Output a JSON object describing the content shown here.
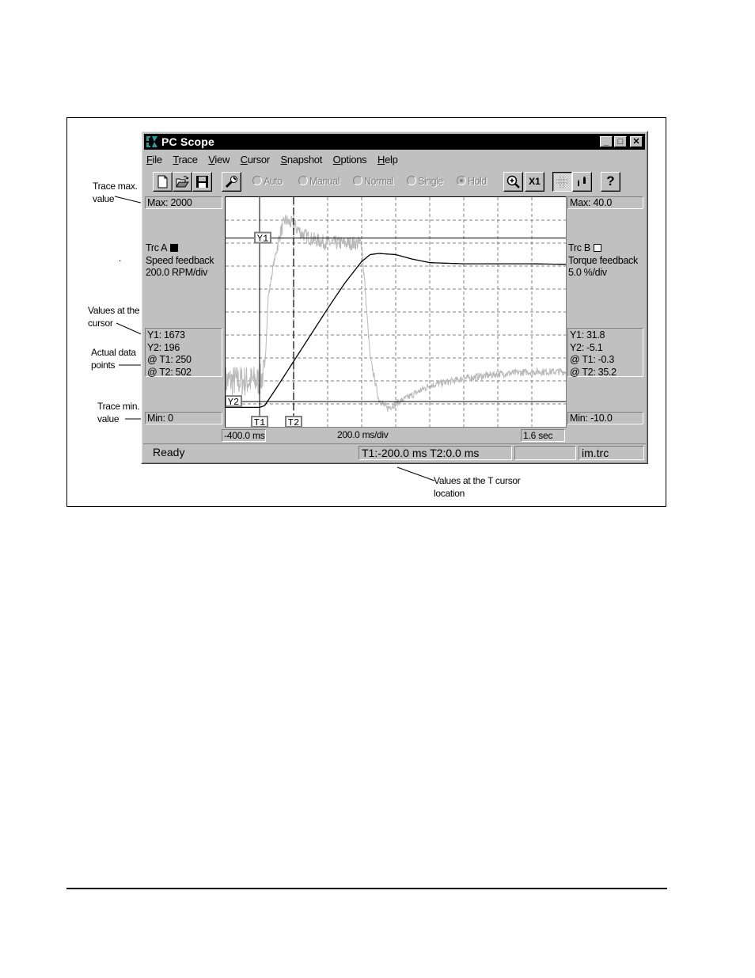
{
  "annotations": {
    "trace_max": "Trace max.\nvalue",
    "cursor_values": "Values at the\ncursor",
    "actual_points": "Actual data\npoints",
    "trace_min": "Trace min.\nvalue",
    "t_cursor": "Values at the T cursor\nlocation",
    "stray_dot": "."
  },
  "window": {
    "title": "PC Scope",
    "controls": {
      "minimize": "_",
      "maximize": "□",
      "close": "✕"
    }
  },
  "menu": [
    {
      "label": "File",
      "accel": "F",
      "rest": "ile"
    },
    {
      "label": "Trace",
      "accel": "T",
      "rest": "race"
    },
    {
      "label": "View",
      "accel": "V",
      "rest": "iew"
    },
    {
      "label": "Cursor",
      "accel": "C",
      "rest": "ursor"
    },
    {
      "label": "Snapshot",
      "accel": "S",
      "rest": "napshot"
    },
    {
      "label": "Options",
      "accel": "O",
      "rest": "ptions"
    },
    {
      "label": "Help",
      "accel": "H",
      "rest": "elp"
    }
  ],
  "toolbar": {
    "buttons": [
      "new-file",
      "open-folder",
      "save-disk",
      "wrench-settings",
      "zoom-in",
      "x1-scale",
      "grid-toggle",
      "cursor-hands",
      "help"
    ],
    "x1_label": "X1",
    "help_label": "?",
    "modes": [
      {
        "label": "Auto",
        "selected": false
      },
      {
        "label": "Manual",
        "selected": false
      },
      {
        "label": "Normal",
        "selected": false
      },
      {
        "label": "Single",
        "selected": false
      },
      {
        "label": "Hold",
        "selected": true
      }
    ]
  },
  "trace_a": {
    "max": "Max:  2000",
    "name": "Trc A",
    "swatch_color": "#000000",
    "signal": "Speed feedback",
    "scale": "200.0 RPM/div",
    "y1": "Y1: 1673",
    "y2": "Y2: 196",
    "t1": "@ T1: 250",
    "t2": "@ T2: 502",
    "min": "Min:  0"
  },
  "trace_b": {
    "max": "Max:  40.0",
    "name": "Trc B",
    "swatch_color": "#ffffff",
    "signal": "Torque feedback",
    "scale": "5.0 %/div",
    "y1": "Y1: 31.8",
    "y2": "Y2: -5.1",
    "t1": "@ T1: -0.3",
    "t2": "@ T2: 35.2",
    "min": "Min:  -10.0"
  },
  "time_axis": {
    "start": "-400.0 ms",
    "scale": "200.0 ms/div",
    "end": "1.6 sec"
  },
  "cursors": {
    "y1": "Y1",
    "y2": "Y2",
    "t1": "T1",
    "t2": "T2"
  },
  "status": {
    "state": "Ready",
    "cursor_times": "T1:-200.0 ms  T2:0.0 ms",
    "empty": "",
    "file": "im.trc"
  },
  "chart_data": {
    "type": "line",
    "title": "",
    "xlabel": "200.0 ms/div",
    "x_unit": "s",
    "xlim": [
      -0.4,
      1.6
    ],
    "grid": true,
    "divisions": {
      "x": 10,
      "y": 10
    },
    "cursor_positions": {
      "T1_s": -0.2,
      "T2_s": 0.0,
      "Y1_frac": 0.822,
      "Y2_frac": 0.11
    },
    "series": [
      {
        "name": "Trc A - Speed feedback",
        "unit": "RPM",
        "ylim": [
          0,
          2000
        ],
        "color": "#000000",
        "x": [
          -0.4,
          -0.2,
          -0.17,
          -0.1,
          0.0,
          0.1,
          0.2,
          0.3,
          0.4,
          0.45,
          0.5,
          0.6,
          0.7,
          0.8,
          1.0,
          1.2,
          1.4,
          1.6
        ],
        "values": [
          170,
          170,
          185,
          340,
          570,
          800,
          1030,
          1250,
          1440,
          1500,
          1510,
          1500,
          1460,
          1430,
          1420,
          1420,
          1420,
          1415
        ]
      },
      {
        "name": "Trc B - Torque feedback",
        "unit": "%",
        "ylim": [
          -10,
          40
        ],
        "color": "#b8b8b8",
        "noisy": true,
        "x": [
          -0.4,
          -0.2,
          -0.17,
          -0.15,
          -0.12,
          -0.08,
          -0.05,
          0.0,
          0.05,
          0.1,
          0.2,
          0.3,
          0.4,
          0.42,
          0.45,
          0.5,
          0.55,
          0.6,
          0.7,
          0.8,
          1.0,
          1.2,
          1.4,
          1.6
        ],
        "values": [
          0,
          0,
          2,
          18,
          25,
          32,
          35,
          34,
          32,
          31,
          30,
          30,
          30,
          20,
          5,
          -4,
          -6,
          -5,
          -3,
          -1,
          0.5,
          1.5,
          2,
          2
        ]
      }
    ]
  }
}
